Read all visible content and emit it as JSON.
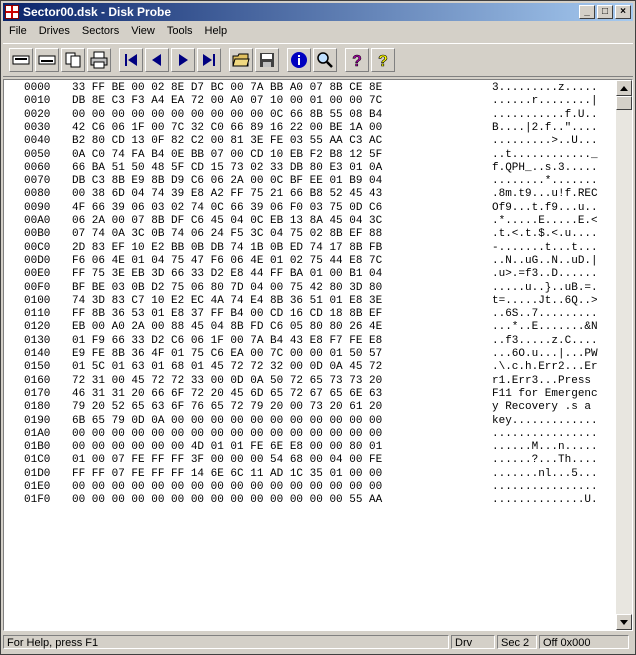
{
  "window": {
    "title": "Sector00.dsk - Disk Probe"
  },
  "title_buttons": [
    "_",
    "□",
    "×"
  ],
  "menu": [
    "File",
    "Drives",
    "Sectors",
    "View",
    "Tools",
    "Help"
  ],
  "toolbar_icons": [
    "read-sector-icon",
    "write-sector-icon",
    "copy-icon",
    "print-icon",
    "first-sector-icon",
    "previous-sector-icon",
    "next-sector-icon",
    "last-sector-icon",
    "open-file-icon",
    "save-file-icon",
    "info-icon",
    "search-icon",
    "help-icon",
    "context-help-icon"
  ],
  "hex_rows": [
    {
      "offset": "0000",
      "bytes": "33 FF BE 00 02 8E D7 BC 00 7A BB A0 07 8B CE 8E",
      "ascii": "3.........z....."
    },
    {
      "offset": "0010",
      "bytes": "DB 8E C3 F3 A4 EA 72 00 A0 07 10 00 01 00 00 7C",
      "ascii": "......r........|"
    },
    {
      "offset": "0020",
      "bytes": "00 00 00 00 00 00 00 00 00 00 0C 66 8B 55 08 B4",
      "ascii": "...........f.U.."
    },
    {
      "offset": "0030",
      "bytes": "42 C6 06 1F 00 7C 32 C0 66 89 16 22 00 BE 1A 00",
      "ascii": "B....|2.f..\"...."
    },
    {
      "offset": "0040",
      "bytes": "B2 80 CD 13 0F 82 C2 00 81 3E FE 03 55 AA C3 AC",
      "ascii": ".........>..U..."
    },
    {
      "offset": "0050",
      "bytes": "0A C0 74 FA B4 0E BB 07 00 CD 10 EB F2 B8 12 5F",
      "ascii": "..t............_"
    },
    {
      "offset": "0060",
      "bytes": "66 BA 51 50 48 5F CD 15 73 02 33 DB 80 E3 01 0A",
      "ascii": "f.QPH_..s.3....."
    },
    {
      "offset": "0070",
      "bytes": "DB C3 8B E9 8B D9 C6 06 2A 00 0C BF EE 01 B9 04",
      "ascii": "........*......."
    },
    {
      "offset": "0080",
      "bytes": "00 38 6D 04 74 39 E8 A2 FF 75 21 66 B8 52 45 43",
      "ascii": ".8m.t9...u!f.REC"
    },
    {
      "offset": "0090",
      "bytes": "4F 66 39 06 03 02 74 0C 66 39 06 F0 03 75 0D C6",
      "ascii": "Of9...t.f9...u.."
    },
    {
      "offset": "00A0",
      "bytes": "06 2A 00 07 8B DF C6 45 04 0C EB 13 8A 45 04 3C",
      "ascii": ".*.....E.....E.<"
    },
    {
      "offset": "00B0",
      "bytes": "07 74 0A 3C 0B 74 06 24 F5 3C 04 75 02 8B EF 88",
      "ascii": ".t.<.t.$.<.u...."
    },
    {
      "offset": "00C0",
      "bytes": "2D 83 EF 10 E2 BB 0B DB 74 1B 0B ED 74 17 8B FB",
      "ascii": "-.......t...t..."
    },
    {
      "offset": "00D0",
      "bytes": "F6 06 4E 01 04 75 47 F6 06 4E 01 02 75 44 E8 7C",
      "ascii": "..N..uG..N..uD.|"
    },
    {
      "offset": "00E0",
      "bytes": "FF 75 3E EB 3D 66 33 D2 E8 44 FF BA 01 00 B1 04",
      "ascii": ".u>.=f3..D......"
    },
    {
      "offset": "00F0",
      "bytes": "BF BE 03 0B D2 75 06 80 7D 04 00 75 42 80 3D 80",
      "ascii": ".....u..}..uB.=."
    },
    {
      "offset": "0100",
      "bytes": "74 3D 83 C7 10 E2 EC 4A 74 E4 8B 36 51 01 E8 3E",
      "ascii": "t=.....Jt..6Q..>"
    },
    {
      "offset": "0110",
      "bytes": "FF 8B 36 53 01 E8 37 FF B4 00 CD 16 CD 18 8B EF",
      "ascii": "..6S..7........."
    },
    {
      "offset": "0120",
      "bytes": "EB 00 A0 2A 00 88 45 04 8B FD C6 05 80 80 26 4E",
      "ascii": "...*..E.......&N"
    },
    {
      "offset": "0130",
      "bytes": "01 F9 66 33 D2 C6 06 1F 00 7A B4 43 E8 F7 FE E8",
      "ascii": "..f3.....z.C...."
    },
    {
      "offset": "0140",
      "bytes": "E9 FE 8B 36 4F 01 75 C6 EA 00 7C 00 00 01 50 57",
      "ascii": "...6O.u...|...PW"
    },
    {
      "offset": "0150",
      "bytes": "01 5C 01 63 01 68 01 45 72 72 32 00 0D 0A 45 72",
      "ascii": ".\\.c.h.Err2...Er"
    },
    {
      "offset": "0160",
      "bytes": "72 31 00 45 72 72 33 00 0D 0A 50 72 65 73 73 20",
      "ascii": "r1.Err3...Press "
    },
    {
      "offset": "0170",
      "bytes": "46 31 31 20 66 6F 72 20 45 6D 65 72 67 65 6E 63",
      "ascii": "F11 for Emergenc"
    },
    {
      "offset": "0180",
      "bytes": "79 20 52 65 63 6F 76 65 72 79 20 00 73 20 61 20",
      "ascii": "y Recovery .s a "
    },
    {
      "offset": "0190",
      "bytes": "6B 65 79 0D 0A 00 00 00 00 00 00 00 00 00 00 00",
      "ascii": "key............."
    },
    {
      "offset": "01A0",
      "bytes": "00 00 00 00 00 00 00 00 00 00 00 00 00 00 00 00",
      "ascii": "................"
    },
    {
      "offset": "01B0",
      "bytes": "00 00 00 00 00 00 4D 01 01 FE 6E E8 00 00 80 01",
      "ascii": "......M...n....."
    },
    {
      "offset": "01C0",
      "bytes": "01 00 07 FE FF FF 3F 00 00 00 54 68 00 04 00 FE",
      "ascii": "......?...Th...."
    },
    {
      "offset": "01D0",
      "bytes": "FF FF 07 FE FF FF 14 6E 6C 11 AD 1C 35 01 00 00",
      "ascii": ".......nl...5..."
    },
    {
      "offset": "01E0",
      "bytes": "00 00 00 00 00 00 00 00 00 00 00 00 00 00 00 00",
      "ascii": "................"
    },
    {
      "offset": "01F0",
      "bytes": "00 00 00 00 00 00 00 00 00 00 00 00 00 00 55 AA",
      "ascii": "..............U."
    }
  ],
  "status": {
    "help": "For Help, press F1",
    "drive": "Drv",
    "sector": "Sec 2",
    "offset": "Off 0x000"
  }
}
